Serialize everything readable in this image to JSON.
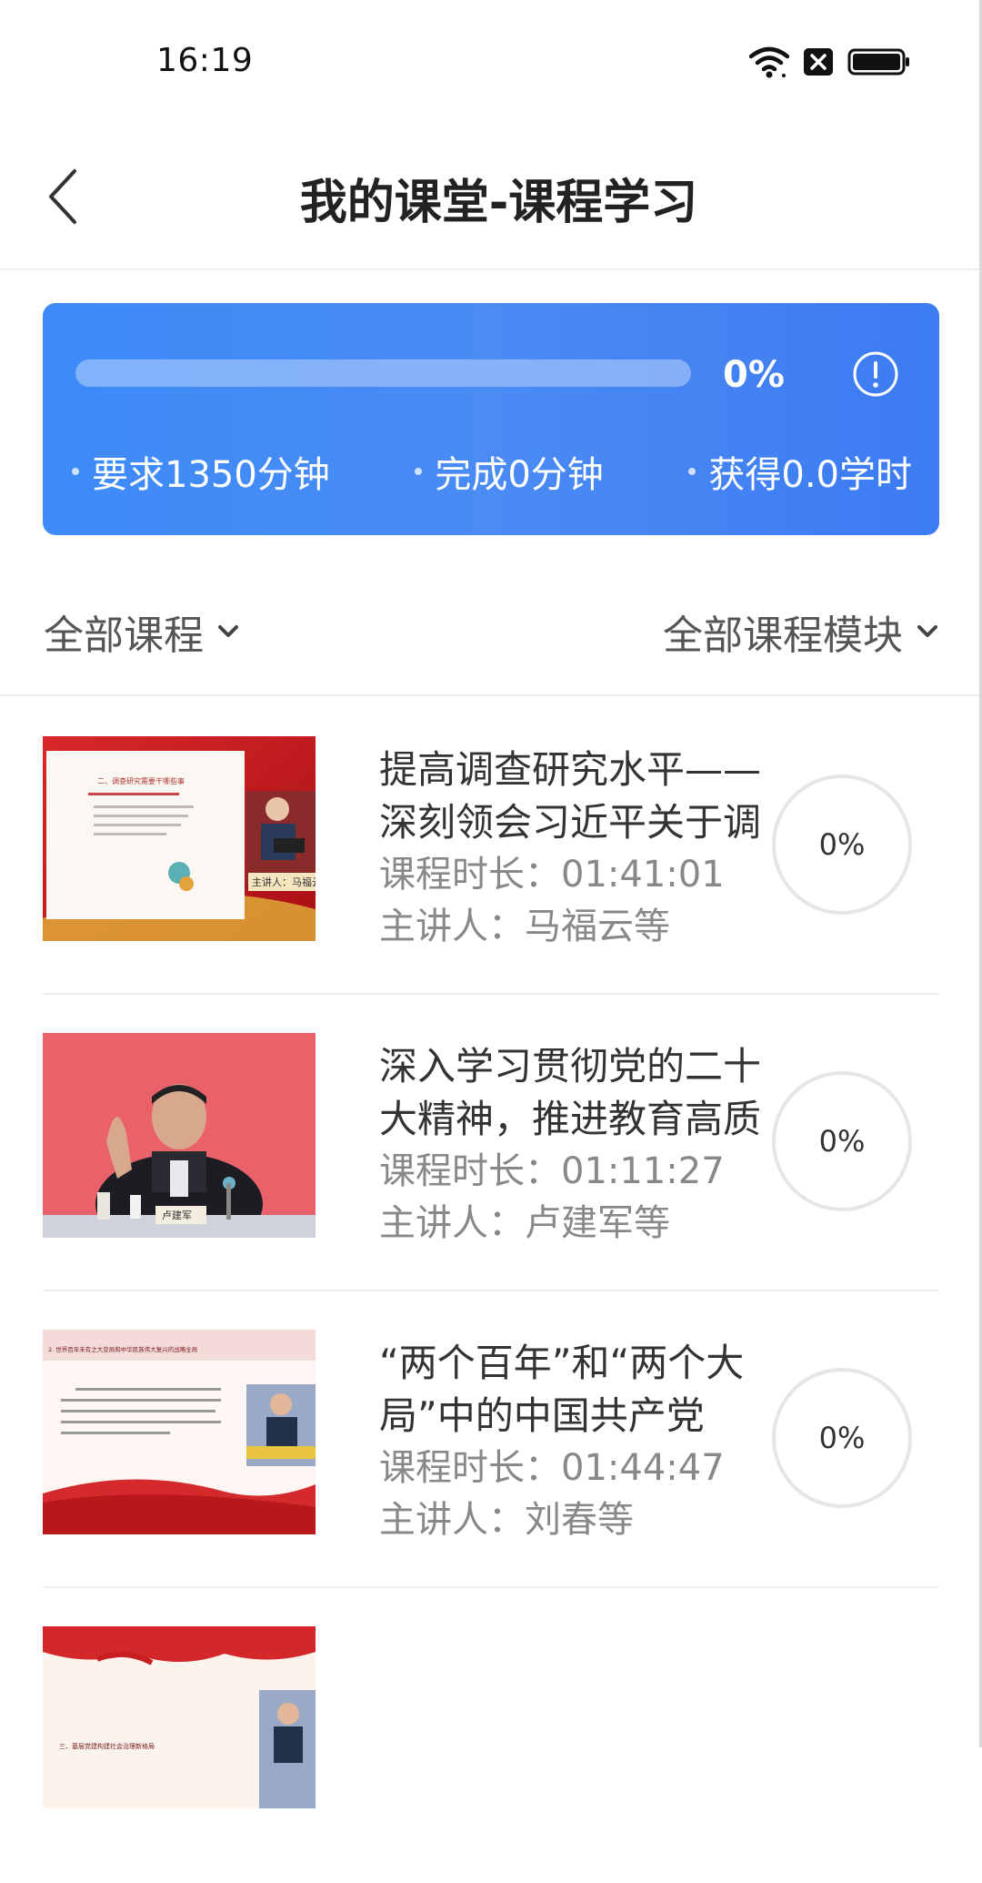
{
  "status_bar": {
    "time": "16:19",
    "icons": [
      "wifi-icon",
      "sim-off-icon",
      "battery-icon"
    ]
  },
  "header": {
    "title": "我的课堂-课程学习",
    "back_icon": "chevron-left-icon"
  },
  "progress": {
    "percent_label": "0%",
    "percent_value": 0,
    "info_icon": "info-circle-icon",
    "stats": {
      "required": "要求1350分钟",
      "completed": "完成0分钟",
      "earned": "获得0.0学时"
    },
    "accent_color": "#4287f5"
  },
  "filters": {
    "category": "全部课程",
    "module": "全部课程模块"
  },
  "courses": [
    {
      "title": "提高调查研究水平——深刻领会习近平关于调查研究的重要论述",
      "duration": "课程时长：01:41:01",
      "speaker": "主讲人：马福云等",
      "progress": "0%"
    },
    {
      "title": "深入学习贯彻党的二十大精神，推进教育高质量发展",
      "duration": "课程时长：01:11:27",
      "speaker": "主讲人：卢建军等",
      "progress": "0%"
    },
    {
      "title": "“两个百年”和“两个大局”中的中国共产党",
      "duration": "课程时长：01:44:47",
      "speaker": "主讲人：刘春等",
      "progress": "0%"
    }
  ],
  "thumbnails": {
    "t1_slide_title": "二、调查研究需要干哪些事",
    "t1_caption": "主讲人：马福云",
    "t2_nameplate": "卢建军",
    "t3_slide_title": "2. 世界百年未有之大变局和中华民族伟大复兴的战略全局",
    "t4_slide_title": "三、基层党建构建社会治理新格局"
  }
}
